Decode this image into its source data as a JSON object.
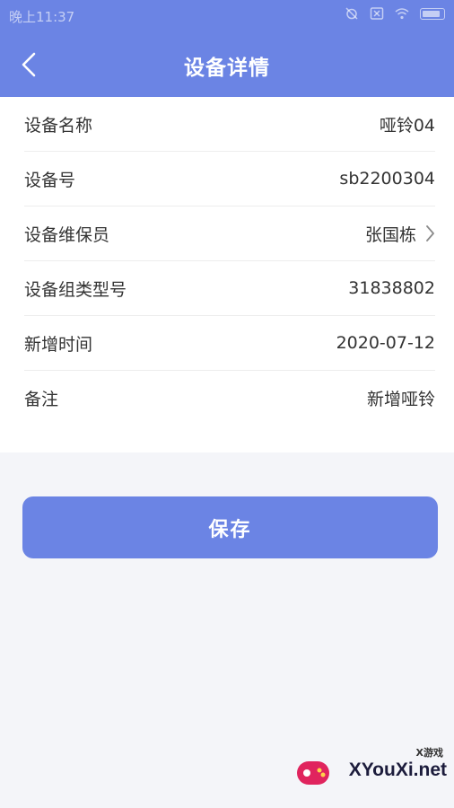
{
  "status_bar": {
    "time": "晚上11:37"
  },
  "nav": {
    "title": "设备详情",
    "back_icon": "chevron-left-icon"
  },
  "details": [
    {
      "label": "设备名称",
      "value": "哑铃04"
    },
    {
      "label": "设备号",
      "value": "sb2200304"
    },
    {
      "label": "设备维保员",
      "value": "张国栋",
      "has_chevron": true
    },
    {
      "label": "设备组类型号",
      "value": "31838802"
    },
    {
      "label": "新增时间",
      "value": "2020-07-12"
    },
    {
      "label": "备注",
      "value": "新增哑铃"
    }
  ],
  "actions": {
    "save_label": "保存"
  },
  "watermark": {
    "small": "X游戏",
    "text": "XYouXi.net"
  },
  "colors": {
    "primary": "#6b84e4",
    "background": "#f4f5f9",
    "card": "#ffffff",
    "text": "#333333"
  }
}
